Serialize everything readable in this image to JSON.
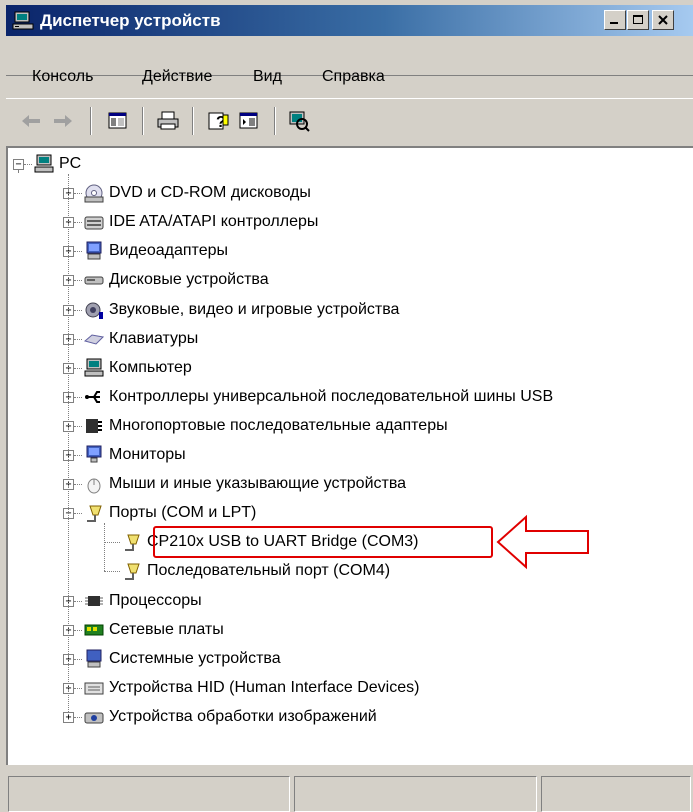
{
  "window": {
    "title": "Диспетчер устройств"
  },
  "menu": {
    "items": [
      {
        "label": "Консоль"
      },
      {
        "label": "Действие"
      },
      {
        "label": "Вид"
      },
      {
        "label": "Справка"
      }
    ]
  },
  "toolbar": {
    "buttons": [
      "back-arrow-icon",
      "forward-arrow-icon",
      "show-hide-tree-icon",
      "print-icon",
      "help-icon",
      "properties-icon",
      "scan-hardware-icon"
    ]
  },
  "tree": {
    "root": {
      "label": "PC",
      "icon": "computer-icon"
    },
    "categories": [
      {
        "label": "DVD и CD-ROM дисководы",
        "icon": "cdrom-icon"
      },
      {
        "label": "IDE ATA/ATAPI контроллеры",
        "icon": "ide-controller-icon"
      },
      {
        "label": "Видеоадаптеры",
        "icon": "display-adapter-icon"
      },
      {
        "label": "Дисковые устройства",
        "icon": "disk-drive-icon"
      },
      {
        "label": "Звуковые, видео и игровые устройства",
        "icon": "sound-icon"
      },
      {
        "label": "Клавиатуры",
        "icon": "keyboard-icon"
      },
      {
        "label": "Компьютер",
        "icon": "computer-icon"
      },
      {
        "label": "Контроллеры универсальной последовательной шины USB",
        "icon": "usb-icon"
      },
      {
        "label": "Многопортовые последовательные адаптеры",
        "icon": "multiport-icon"
      },
      {
        "label": "Мониторы",
        "icon": "monitor-icon"
      },
      {
        "label": "Мыши и иные указывающие устройства",
        "icon": "mouse-icon"
      },
      {
        "label": "Порты (COM и LPT)",
        "icon": "port-icon"
      },
      {
        "label": "Процессоры",
        "icon": "processor-icon"
      },
      {
        "label": "Сетевые платы",
        "icon": "network-card-icon"
      },
      {
        "label": "Системные устройства",
        "icon": "system-device-icon"
      },
      {
        "label": "Устройства HID (Human Interface Devices)",
        "icon": "hid-icon"
      },
      {
        "label": "Устройства обработки изображений",
        "icon": "imaging-icon"
      }
    ],
    "ports_children": [
      {
        "label": "CP210x USB to UART Bridge (COM3)",
        "icon": "port-icon"
      },
      {
        "label": "Последовательный порт (COM4)",
        "icon": "port-icon"
      }
    ]
  },
  "colors": {
    "title_gradient_start": "#0a246a",
    "title_gradient_end": "#a6caf0",
    "window_bg": "#d4d0c8",
    "highlight": "#e00000"
  }
}
